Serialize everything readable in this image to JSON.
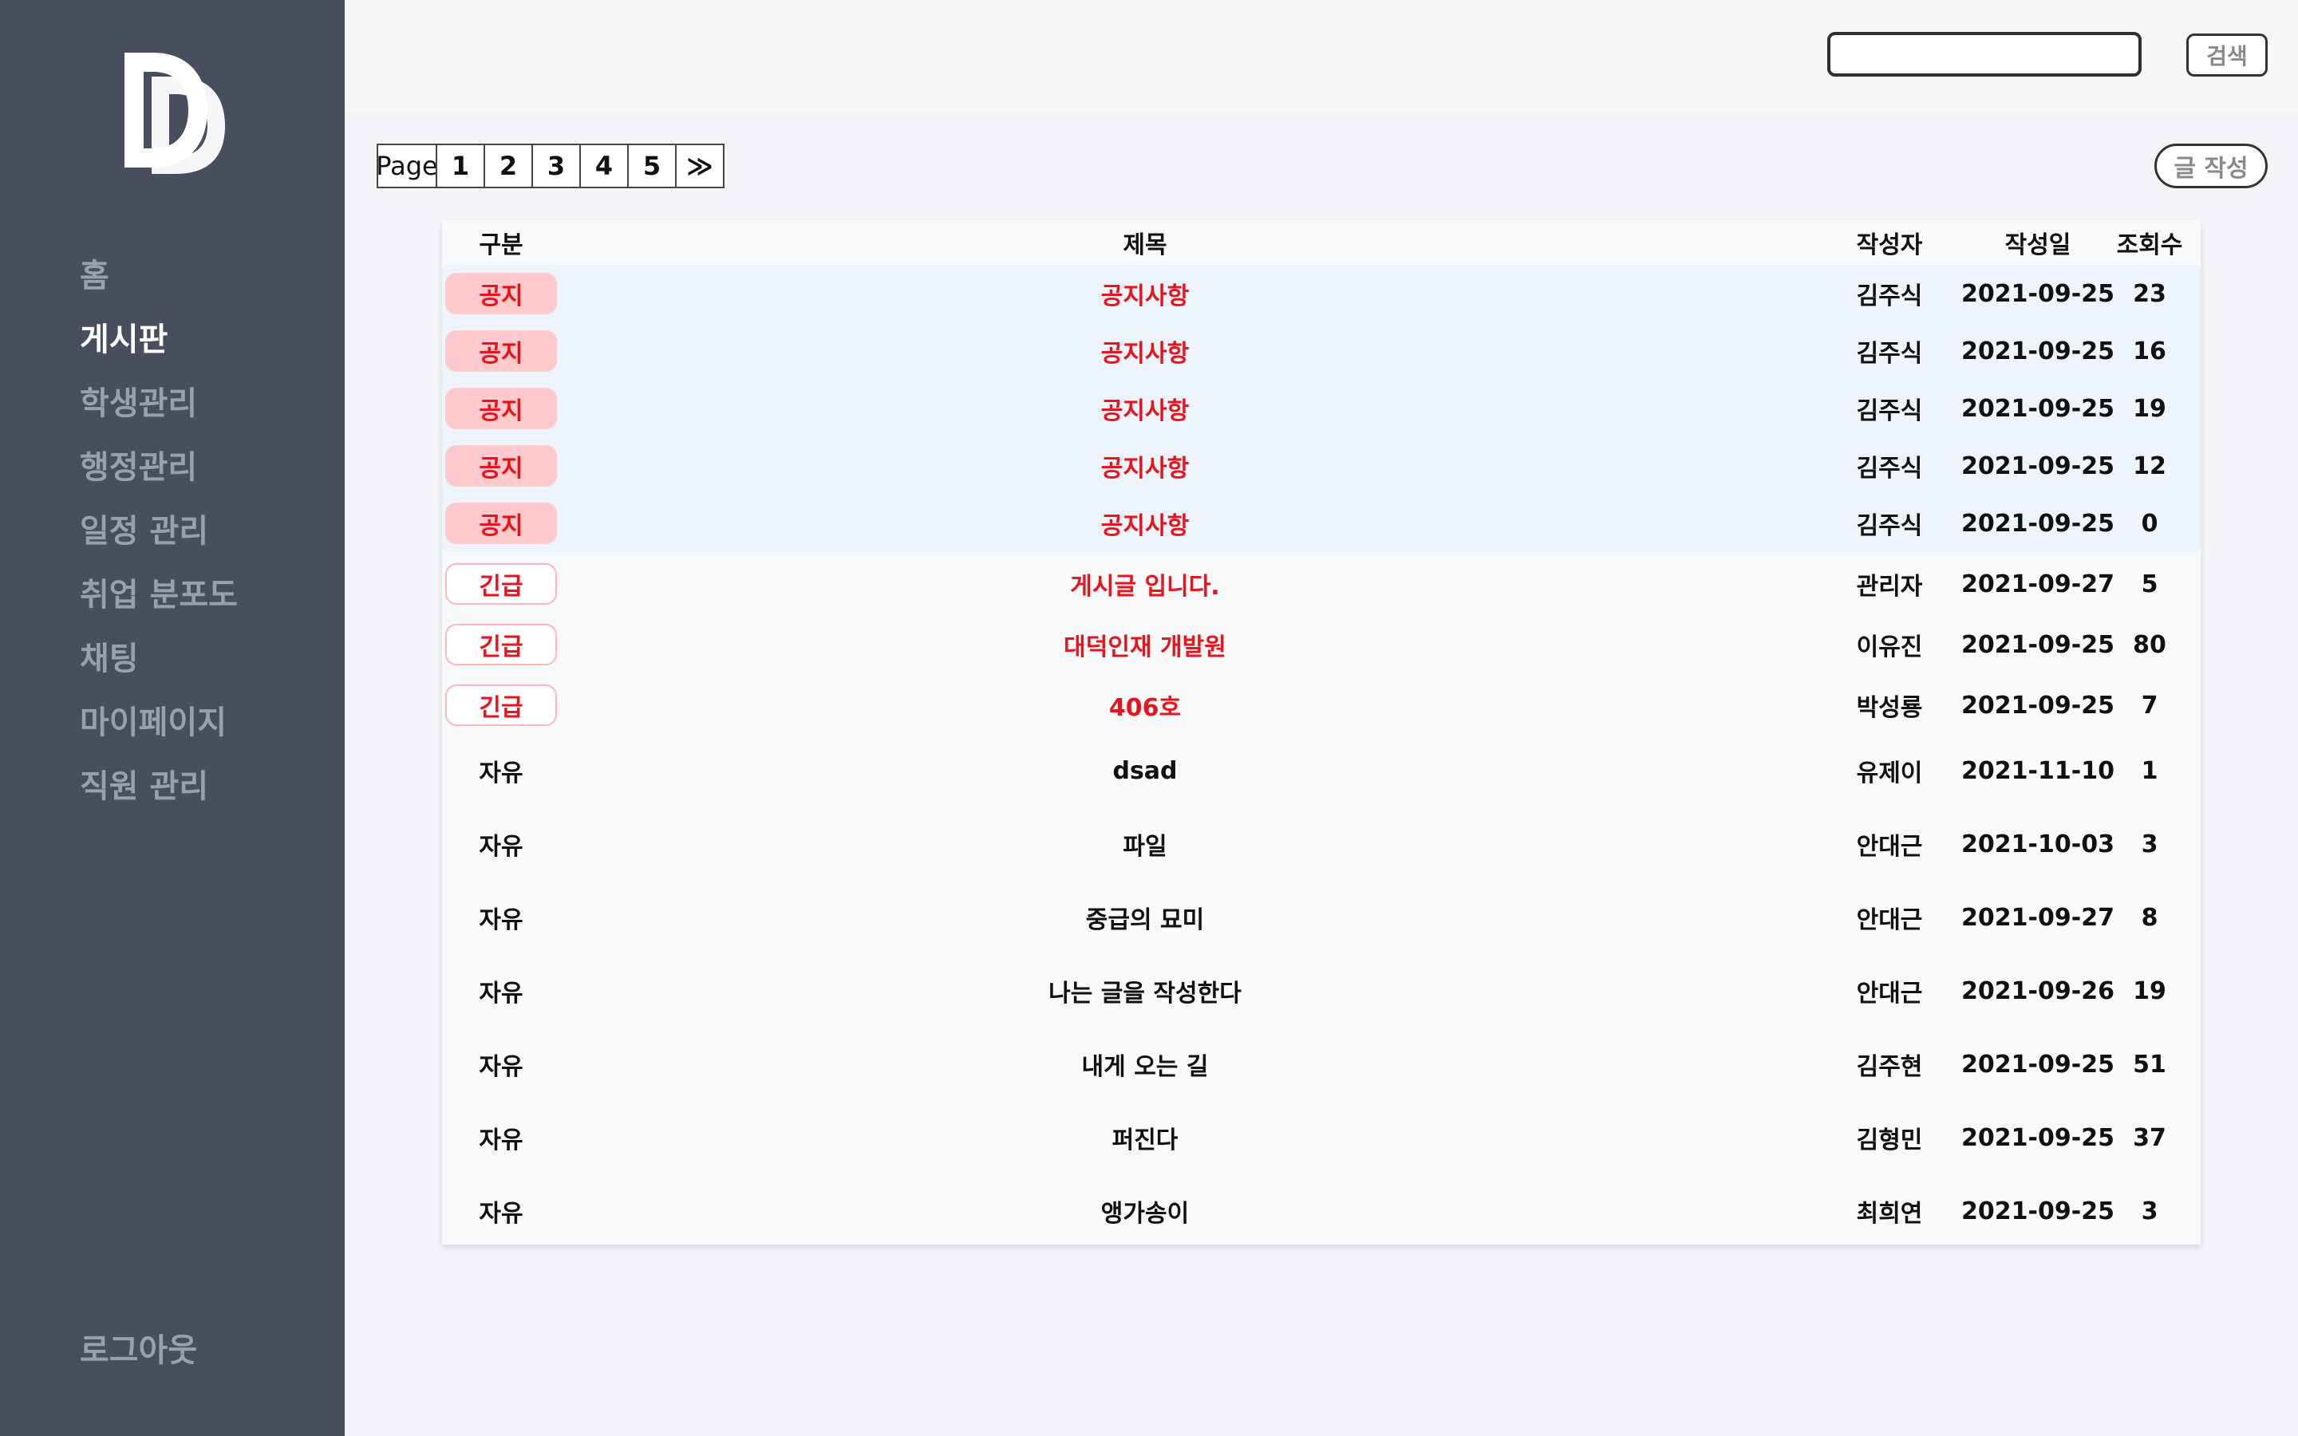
{
  "sidebar": {
    "logo_text": "DD",
    "nav": [
      "홈",
      "게시판",
      "학생관리",
      "행정관리",
      "일정 관리",
      "취업 분포도",
      "채팅",
      "마이페이지",
      "직원 관리"
    ],
    "active_index": 1,
    "logout": "로그아웃"
  },
  "topbar": {
    "search_placeholder": "",
    "search_value": "",
    "search_button": "검색"
  },
  "pager": {
    "label": "Page",
    "pages": [
      "1",
      "2",
      "3",
      "4",
      "5"
    ],
    "next": "≫"
  },
  "write_button": "글 작성",
  "table": {
    "headers": {
      "category": "구분",
      "title": "제목",
      "author": "작성자",
      "date": "작성일",
      "views": "조회수"
    },
    "rows": [
      {
        "category": "공지",
        "title": "공지사항",
        "author": "김주식",
        "date": "2021-09-25",
        "views": "23"
      },
      {
        "category": "공지",
        "title": "공지사항",
        "author": "김주식",
        "date": "2021-09-25",
        "views": "16"
      },
      {
        "category": "공지",
        "title": "공지사항",
        "author": "김주식",
        "date": "2021-09-25",
        "views": "19"
      },
      {
        "category": "공지",
        "title": "공지사항",
        "author": "김주식",
        "date": "2021-09-25",
        "views": "12"
      },
      {
        "category": "공지",
        "title": "공지사항",
        "author": "김주식",
        "date": "2021-09-25",
        "views": "0"
      },
      {
        "category": "긴급",
        "title": "게시글 입니다.",
        "author": "관리자",
        "date": "2021-09-27",
        "views": "5"
      },
      {
        "category": "긴급",
        "title": "대덕인재 개발원",
        "author": "이유진",
        "date": "2021-09-25",
        "views": "80"
      },
      {
        "category": "긴급",
        "title": "406호",
        "author": "박성룡",
        "date": "2021-09-25",
        "views": "7"
      },
      {
        "category": "자유",
        "title": "dsad",
        "author": "유제이",
        "date": "2021-11-10",
        "views": "1"
      },
      {
        "category": "자유",
        "title": "파일",
        "author": "안대근",
        "date": "2021-10-03",
        "views": "3"
      },
      {
        "category": "자유",
        "title": "중급의 묘미",
        "author": "안대근",
        "date": "2021-09-27",
        "views": "8"
      },
      {
        "category": "자유",
        "title": "나는 글을 작성한다",
        "author": "안대근",
        "date": "2021-09-26",
        "views": "19"
      },
      {
        "category": "자유",
        "title": "내게 오는 길",
        "author": "김주현",
        "date": "2021-09-25",
        "views": "51"
      },
      {
        "category": "자유",
        "title": "퍼진다",
        "author": "김형민",
        "date": "2021-09-25",
        "views": "37"
      },
      {
        "category": "자유",
        "title": "앵가송이",
        "author": "최희연",
        "date": "2021-09-25",
        "views": "3"
      }
    ]
  },
  "colors": {
    "sidebar_bg": "#474f5f",
    "accent_red": "#e8141c",
    "notice_badge_bg": "#ffc9cd",
    "urgent_badge_border": "#ffb7bd"
  }
}
